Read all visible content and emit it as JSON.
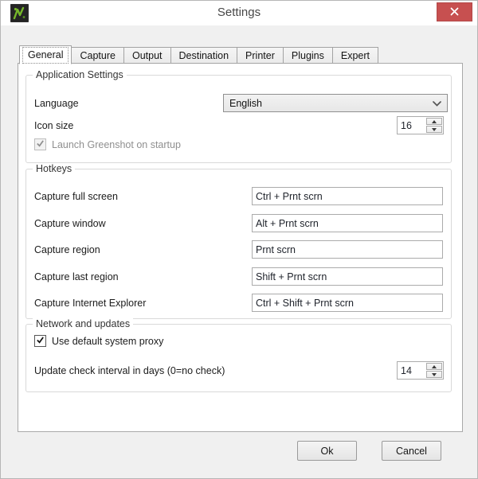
{
  "window": {
    "title": "Settings"
  },
  "icons": {
    "app": "greenshot-logo-icon",
    "close": "close-icon",
    "language_dropdown": "chevron-down-icon",
    "spinner_up": "up-arrow-icon",
    "spinner_down": "down-arrow-icon",
    "checkbox_check": "check-icon"
  },
  "tabs": {
    "active": "General",
    "items": [
      "General",
      "Capture",
      "Output",
      "Destination",
      "Printer",
      "Plugins",
      "Expert"
    ]
  },
  "groups": {
    "application": {
      "title": "Application Settings",
      "language": {
        "label": "Language",
        "value": "English"
      },
      "icon_size": {
        "label": "Icon size",
        "value": "16"
      },
      "startup": {
        "label": "Launch Greenshot on startup",
        "checked": true,
        "enabled": false
      }
    },
    "hotkeys": {
      "title": "Hotkeys",
      "rows": [
        {
          "label": "Capture full screen",
          "value": "Ctrl + Prnt scrn"
        },
        {
          "label": "Capture window",
          "value": "Alt + Prnt scrn"
        },
        {
          "label": "Capture region",
          "value": "Prnt scrn"
        },
        {
          "label": "Capture last region",
          "value": "Shift + Prnt scrn"
        },
        {
          "label": "Capture Internet Explorer",
          "value": "Ctrl + Shift + Prnt scrn"
        }
      ]
    },
    "network": {
      "title": "Network and updates",
      "proxy": {
        "label": "Use default system proxy",
        "checked": true,
        "enabled": true
      },
      "update_interval": {
        "label": "Update check interval in days (0=no check)",
        "value": "14"
      }
    }
  },
  "buttons": {
    "ok": "Ok",
    "cancel": "Cancel"
  },
  "colors": {
    "close_button": "#c75050",
    "logo_green": "#76b82a",
    "titlebar_bg": "#ffffff",
    "dialog_bg": "#f0f0f0"
  }
}
